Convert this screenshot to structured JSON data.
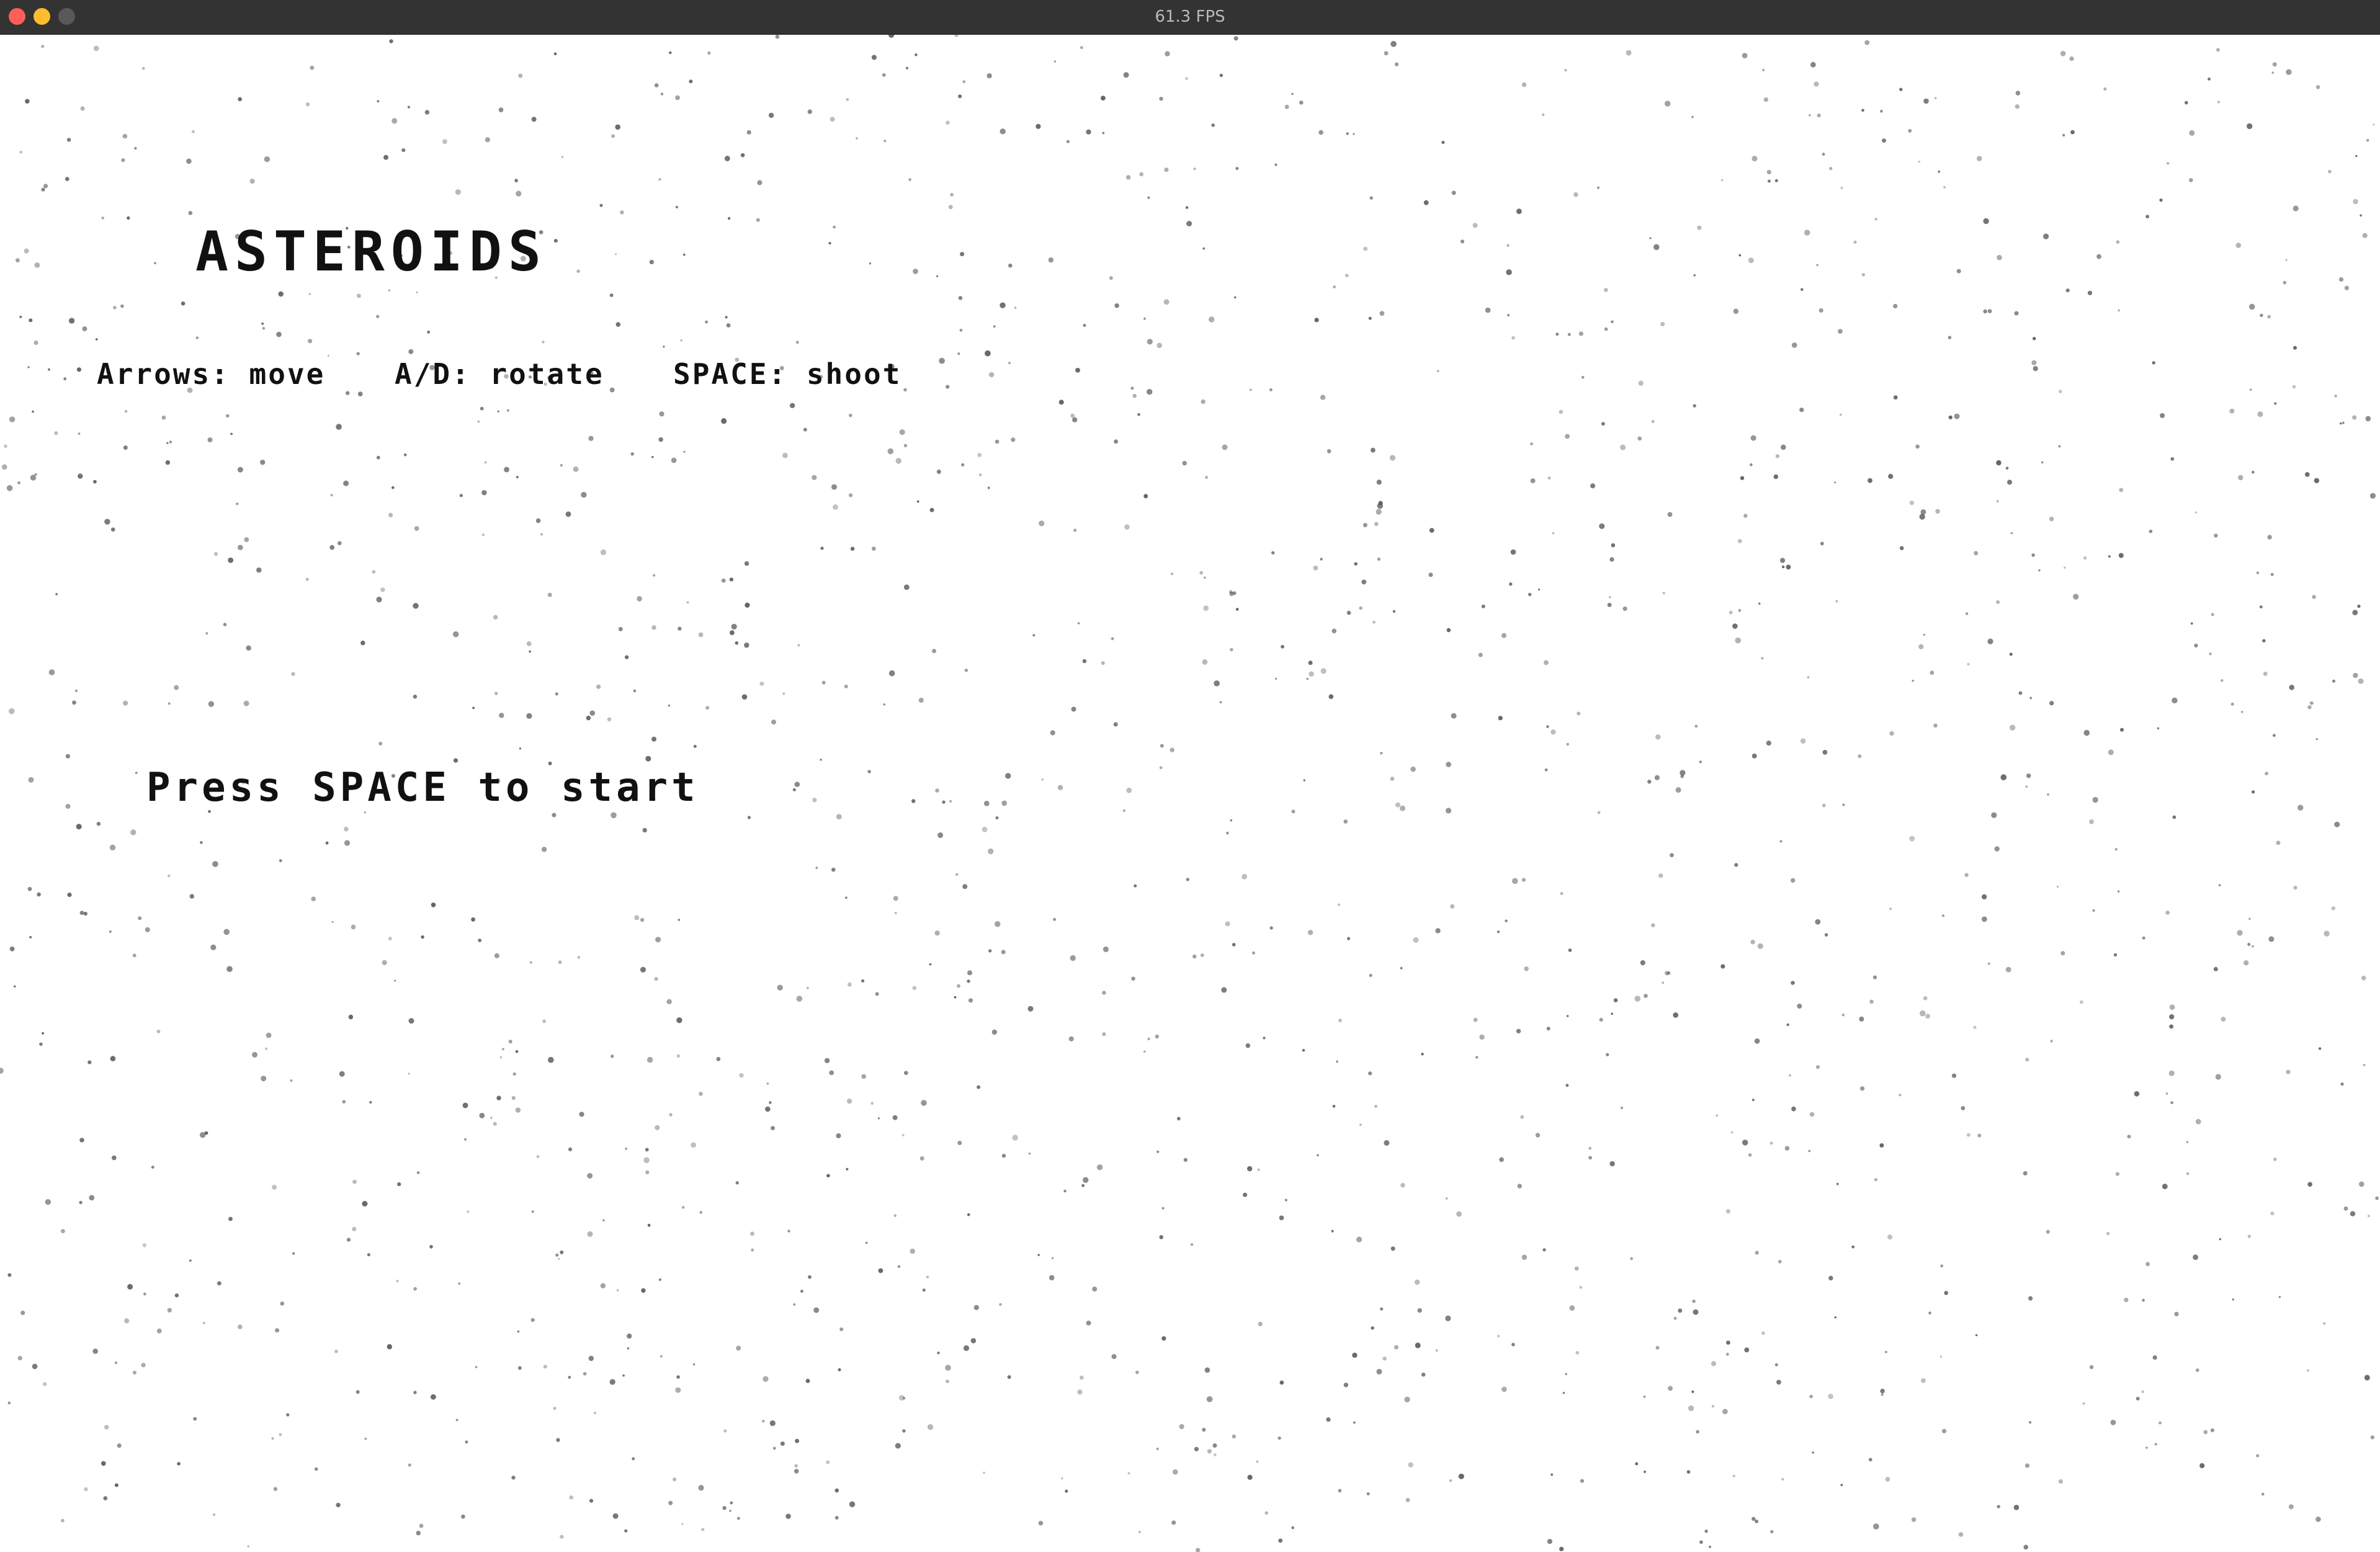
{
  "window": {
    "title": "61.3 FPS",
    "traffic_lights": {
      "close_color": "#ff5f57",
      "minimize_color": "#febc2e",
      "zoom_color": "#595959"
    }
  },
  "game": {
    "title": "ASTEROIDS",
    "controls": {
      "move": "Arrows: move",
      "rotate": "A/D: rotate",
      "shoot": "SPACE: shoot"
    },
    "start_prompt": "Press SPACE to start",
    "colors": {
      "background": "#ffffff",
      "text": "#111111",
      "stars": "#555555"
    }
  }
}
